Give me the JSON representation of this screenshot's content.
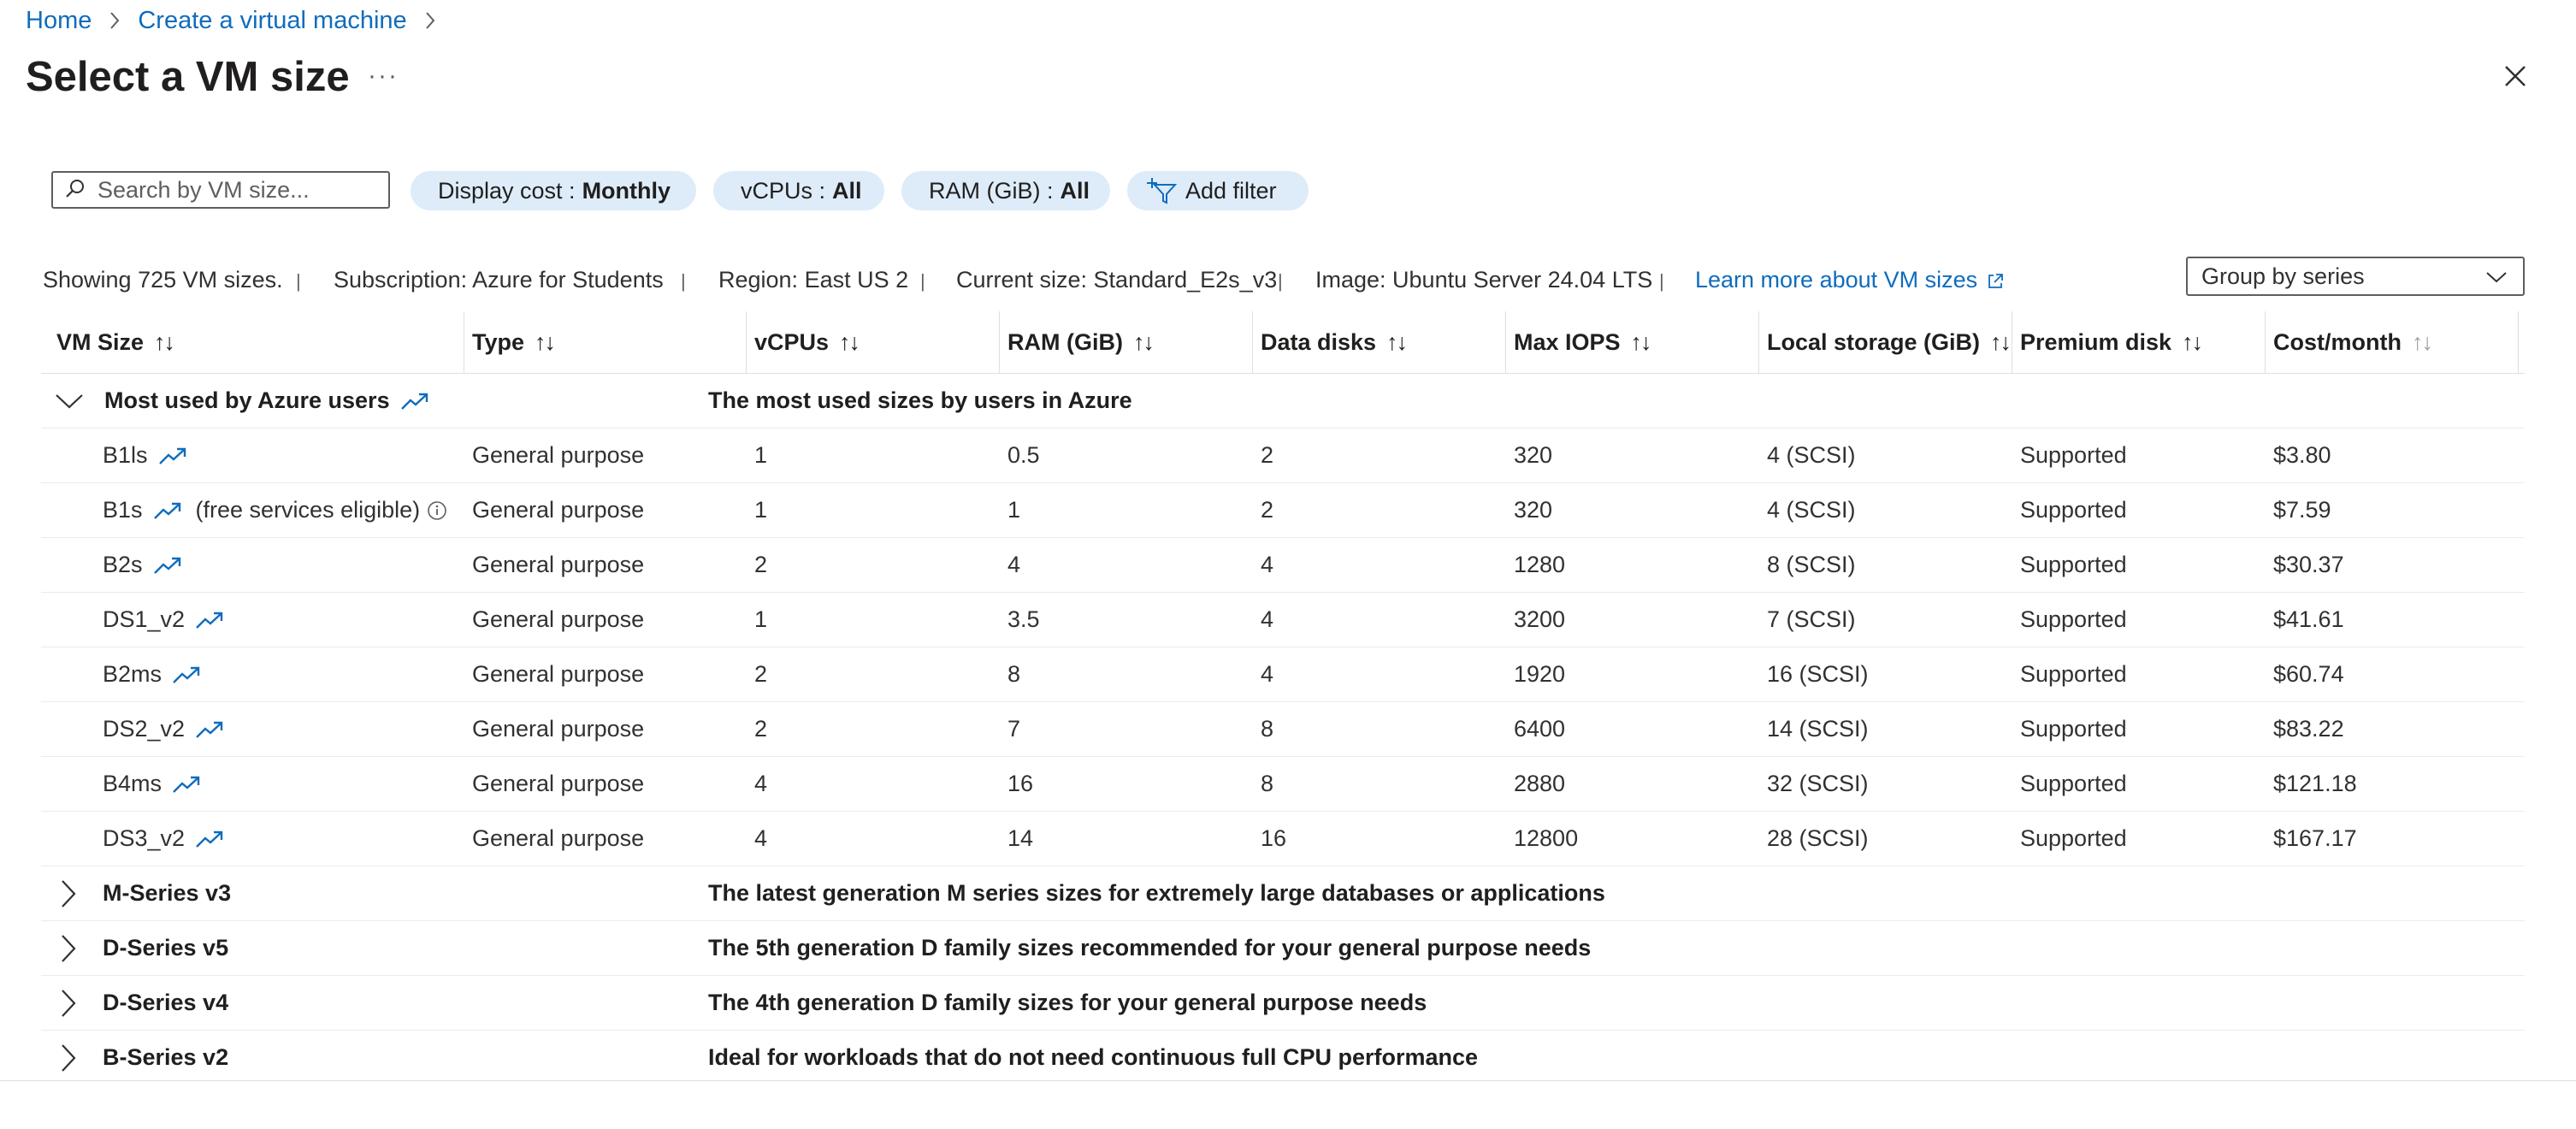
{
  "breadcrumb": [
    {
      "label": "Home"
    },
    {
      "label": "Create a virtual machine"
    }
  ],
  "page": {
    "title": "Select a VM size",
    "more": "···"
  },
  "search": {
    "placeholder": "Search by VM size..."
  },
  "filters": [
    {
      "label": "Display cost :",
      "value": "Monthly"
    },
    {
      "label": "vCPUs :",
      "value": "All"
    },
    {
      "label": "RAM (GiB) :",
      "value": "All"
    },
    {
      "label": "Add filter",
      "value": ""
    }
  ],
  "info": {
    "showing": "Showing 725 VM sizes.",
    "subscription": "Subscription: Azure for Students",
    "region": "Region: East US 2",
    "current_size": "Current size: Standard_E2s_v3",
    "image": "Image: Ubuntu Server 24.04 LTS",
    "learn_more": "Learn more about VM sizes",
    "separator": "|"
  },
  "group_by": {
    "value": "Group by series"
  },
  "columns": [
    {
      "label": "VM Size",
      "sort": "↑↓"
    },
    {
      "label": "Type",
      "sort": "↑↓"
    },
    {
      "label": "vCPUs",
      "sort": "↑↓"
    },
    {
      "label": "RAM (GiB)",
      "sort": "↑↓"
    },
    {
      "label": "Data disks",
      "sort": "↑↓"
    },
    {
      "label": "Max IOPS",
      "sort": "↑↓"
    },
    {
      "label": "Local storage (GiB)",
      "sort": "↑↓"
    },
    {
      "label": "Premium disk",
      "sort": "↑↓"
    },
    {
      "label": "Cost/month",
      "sort": "↑↓"
    }
  ],
  "groups": [
    {
      "name": "Most used by Azure users",
      "description": "The most used sizes by users in Azure",
      "expanded": true
    },
    {
      "name": "M-Series v3",
      "description": "The latest generation M series sizes for extremely large databases or applications",
      "expanded": false
    },
    {
      "name": "D-Series v5",
      "description": "The 5th generation D family sizes recommended for your general purpose needs",
      "expanded": false
    },
    {
      "name": "D-Series v4",
      "description": "The 4th generation D family sizes for your general purpose needs",
      "expanded": false
    },
    {
      "name": "B-Series v2",
      "description": "Ideal for workloads that do not need continuous full CPU performance",
      "expanded": false
    }
  ],
  "rows": [
    {
      "size": "B1ls",
      "note": "",
      "type": "General purpose",
      "vcpus": "1",
      "ram": "0.5",
      "disks": "2",
      "iops": "320",
      "storage": "4 (SCSI)",
      "premium": "Supported",
      "cost": "$3.80"
    },
    {
      "size": "B1s",
      "note": "(free services eligible)",
      "type": "General purpose",
      "vcpus": "1",
      "ram": "1",
      "disks": "2",
      "iops": "320",
      "storage": "4 (SCSI)",
      "premium": "Supported",
      "cost": "$7.59"
    },
    {
      "size": "B2s",
      "note": "",
      "type": "General purpose",
      "vcpus": "2",
      "ram": "4",
      "disks": "4",
      "iops": "1280",
      "storage": "8 (SCSI)",
      "premium": "Supported",
      "cost": "$30.37"
    },
    {
      "size": "DS1_v2",
      "note": "",
      "type": "General purpose",
      "vcpus": "1",
      "ram": "3.5",
      "disks": "4",
      "iops": "3200",
      "storage": "7 (SCSI)",
      "premium": "Supported",
      "cost": "$41.61"
    },
    {
      "size": "B2ms",
      "note": "",
      "type": "General purpose",
      "vcpus": "2",
      "ram": "8",
      "disks": "4",
      "iops": "1920",
      "storage": "16 (SCSI)",
      "premium": "Supported",
      "cost": "$60.74"
    },
    {
      "size": "DS2_v2",
      "note": "",
      "type": "General purpose",
      "vcpus": "2",
      "ram": "7",
      "disks": "8",
      "iops": "6400",
      "storage": "14 (SCSI)",
      "premium": "Supported",
      "cost": "$83.22"
    },
    {
      "size": "B4ms",
      "note": "",
      "type": "General purpose",
      "vcpus": "4",
      "ram": "16",
      "disks": "8",
      "iops": "2880",
      "storage": "32 (SCSI)",
      "premium": "Supported",
      "cost": "$121.18"
    },
    {
      "size": "DS3_v2",
      "note": "",
      "type": "General purpose",
      "vcpus": "4",
      "ram": "14",
      "disks": "16",
      "iops": "12800",
      "storage": "28 (SCSI)",
      "premium": "Supported",
      "cost": "$167.17"
    }
  ],
  "icons": {
    "search": "search-icon",
    "filter": "filter-add-icon",
    "trend": "trending-icon",
    "info": "info-icon",
    "close": "close-icon",
    "chevron": "chevron-icon",
    "external": "external-link-icon"
  },
  "colors": {
    "link": "#0f6cbd",
    "pill_bg": "#deecf9",
    "text": "#323130"
  }
}
